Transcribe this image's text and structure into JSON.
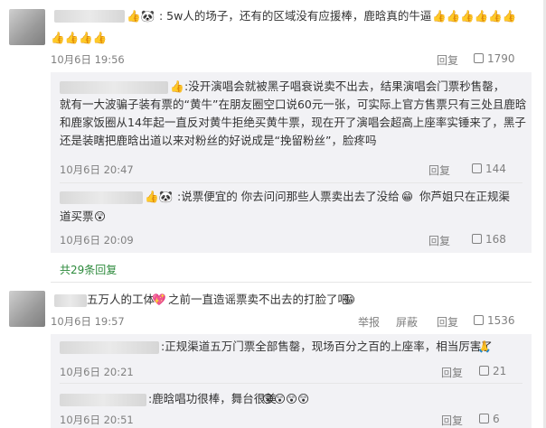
{
  "comment1": {
    "badge_emojis": "👍🐼",
    "text": ": 5w人的场子，还有的区域没有应援棒，鹿晗真的牛逼",
    "text_emojis_line1": "👍👍👍👍👍👍",
    "text_emojis_line2": "👍👍👍👍",
    "time": "10月6日 19:56",
    "reply_label": "回复",
    "like_count": "1790"
  },
  "reply1": {
    "line1": ":没开演唱会就被黑子唱衰说卖不出去，结果演唱会门票秒售罄，",
    "line2": "就有一大波骗子装有票的“黄牛”在朋友圈空口说60元一张，可实际上官方售票只有三处且鹿晗",
    "line3": "和鹿家饭圈从14年起一直反对黄牛拒绝买黄牛票，现在开了演唱会超高上座率实锤来了，黑子",
    "line4": "还是装瞎把鹿晗出道以来对粉丝的好说成是“挽留粉丝”，脸疼吗",
    "time": "10月6日 20:47",
    "reply_label": "回复",
    "like_count": "144"
  },
  "reply2": {
    "line1": ":说票便宜的 你去问问那些人票卖出去了没给",
    "line1b": "你芦姐只在正规渠",
    "line2": "道买票",
    "time": "10月6日 20:09",
    "reply_label": "回复",
    "like_count": "168"
  },
  "more_replies": "共29条回复",
  "comment2": {
    "text": "五万人的工体",
    "text2": "之前一直造谣票卖不出去的打脸了吧",
    "time": "10月6日 19:57",
    "report_label": "举报",
    "block_label": "屏蔽",
    "reply_label": "回复",
    "like_count": "1536"
  },
  "reply3": {
    "text": ":正规渠道五万门票全部售罄，现场百分之百的上座率，相当厉害了",
    "time": "10月6日 20:21",
    "reply_label": "回复",
    "like_count": "21"
  },
  "reply4": {
    "text": ":鹿晗唱功很棒，舞台很美",
    "time": "10月6日 20:51",
    "reply_label": "回复",
    "like_count": "6"
  }
}
